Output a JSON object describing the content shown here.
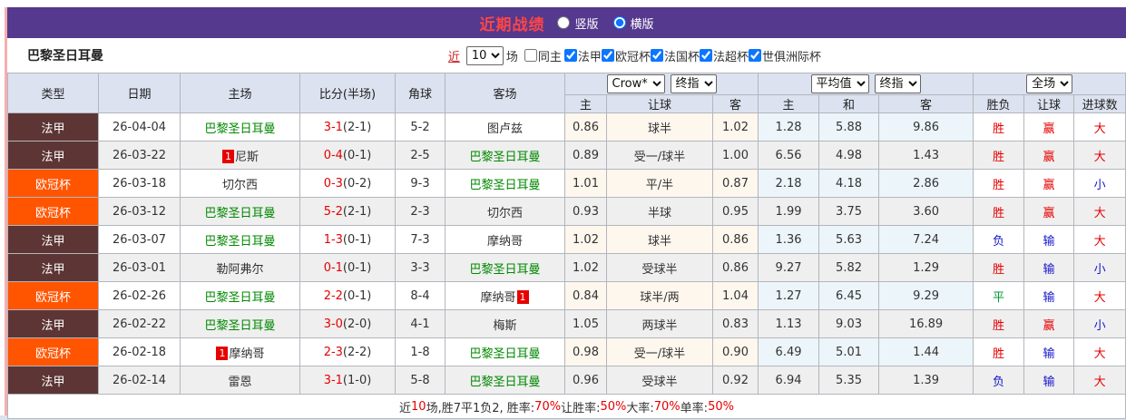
{
  "colors": {
    "titlebar_bg": "#54398e",
    "title_red": "#ff4545",
    "self_team_green": "#008800",
    "score_red": "#e60000",
    "result_red": "#e60000",
    "result_blue": "#1515cc",
    "result_green": "#009933",
    "type_colors": {
      "法甲": "#5d3535",
      "欧冠杯": "#ff5500"
    }
  },
  "title_bar": {
    "title": "近期战绩",
    "radio_vertical": "竖版",
    "radio_horizontal": "横版",
    "selected": "横版"
  },
  "filter_bar": {
    "team_name": "巴黎圣日耳曼",
    "recent_label": "近",
    "recent_count": "10",
    "matches_label": "场",
    "same_home_label": "同主",
    "same_home_checked": false,
    "leagues": [
      "法甲",
      "欧冠杯",
      "法国杯",
      "法超杯",
      "世俱洲际杯"
    ]
  },
  "table": {
    "selects": {
      "company": "Crow*",
      "stage1": "终指",
      "average": "平均值",
      "stage2": "终指",
      "scope": "全场"
    },
    "main_headers": [
      "类型",
      "日期",
      "主场",
      "比分(半场)",
      "角球",
      "客场"
    ],
    "sub_headers": [
      "主",
      "让球",
      "客",
      "主",
      "和",
      "客",
      "胜负",
      "让球",
      "进球数"
    ],
    "rows": [
      {
        "type": "法甲",
        "date": "26-04-04",
        "home": {
          "name": "巴黎圣日耳曼",
          "self": true
        },
        "ft": "3-1",
        "ht": "(2-1)",
        "corner": "5-2",
        "away": {
          "name": "图卢兹",
          "self": false
        },
        "odds": [
          "0.86",
          "球半",
          "1.02"
        ],
        "avg": [
          "1.28",
          "5.88",
          "9.86"
        ],
        "res": [
          [
            "胜",
            "r"
          ],
          [
            "赢",
            "r"
          ],
          [
            "大",
            "r"
          ]
        ]
      },
      {
        "type": "法甲",
        "date": "26-03-22",
        "home": {
          "name": "尼斯",
          "self": false,
          "badge": "1",
          "badge_pos": "before"
        },
        "ft": "0-4",
        "ht": "(0-1)",
        "corner": "2-5",
        "away": {
          "name": "巴黎圣日耳曼",
          "self": true
        },
        "odds": [
          "0.89",
          "受一/球半",
          "1.00"
        ],
        "avg": [
          "6.56",
          "4.98",
          "1.43"
        ],
        "res": [
          [
            "胜",
            "r"
          ],
          [
            "赢",
            "r"
          ],
          [
            "大",
            "r"
          ]
        ]
      },
      {
        "type": "欧冠杯",
        "date": "26-03-18",
        "home": {
          "name": "切尔西",
          "self": false
        },
        "ft": "0-3",
        "ht": "(0-2)",
        "corner": "9-3",
        "away": {
          "name": "巴黎圣日耳曼",
          "self": true
        },
        "odds": [
          "1.01",
          "平/半",
          "0.87"
        ],
        "avg": [
          "2.18",
          "4.18",
          "2.86"
        ],
        "res": [
          [
            "胜",
            "r"
          ],
          [
            "赢",
            "r"
          ],
          [
            "小",
            "b"
          ]
        ]
      },
      {
        "type": "欧冠杯",
        "date": "26-03-12",
        "home": {
          "name": "巴黎圣日耳曼",
          "self": true
        },
        "ft": "5-2",
        "ht": "(2-1)",
        "corner": "2-3",
        "away": {
          "name": "切尔西",
          "self": false
        },
        "odds": [
          "0.93",
          "半球",
          "0.95"
        ],
        "avg": [
          "1.99",
          "3.75",
          "3.60"
        ],
        "res": [
          [
            "胜",
            "r"
          ],
          [
            "赢",
            "r"
          ],
          [
            "大",
            "r"
          ]
        ]
      },
      {
        "type": "法甲",
        "date": "26-03-07",
        "home": {
          "name": "巴黎圣日耳曼",
          "self": true
        },
        "ft": "1-3",
        "ht": "(0-1)",
        "corner": "7-3",
        "away": {
          "name": "摩纳哥",
          "self": false
        },
        "odds": [
          "1.02",
          "球半",
          "0.86"
        ],
        "avg": [
          "1.36",
          "5.63",
          "7.24"
        ],
        "res": [
          [
            "负",
            "b"
          ],
          [
            "输",
            "b"
          ],
          [
            "大",
            "r"
          ]
        ]
      },
      {
        "type": "法甲",
        "date": "26-03-01",
        "home": {
          "name": "勒阿弗尔",
          "self": false
        },
        "ft": "0-1",
        "ht": "(0-1)",
        "corner": "3-3",
        "away": {
          "name": "巴黎圣日耳曼",
          "self": true
        },
        "odds": [
          "1.02",
          "受球半",
          "0.86"
        ],
        "avg": [
          "9.27",
          "5.82",
          "1.29"
        ],
        "res": [
          [
            "胜",
            "r"
          ],
          [
            "输",
            "b"
          ],
          [
            "小",
            "b"
          ]
        ]
      },
      {
        "type": "欧冠杯",
        "date": "26-02-26",
        "home": {
          "name": "巴黎圣日耳曼",
          "self": true
        },
        "ft": "2-2",
        "ht": "(0-1)",
        "corner": "8-4",
        "away": {
          "name": "摩纳哥",
          "self": false,
          "badge": "1",
          "badge_pos": "after"
        },
        "odds": [
          "0.84",
          "球半/两",
          "1.04"
        ],
        "avg": [
          "1.27",
          "6.45",
          "9.29"
        ],
        "res": [
          [
            "平",
            "g"
          ],
          [
            "输",
            "b"
          ],
          [
            "大",
            "r"
          ]
        ]
      },
      {
        "type": "法甲",
        "date": "26-02-22",
        "home": {
          "name": "巴黎圣日耳曼",
          "self": true
        },
        "ft": "3-0",
        "ht": "(2-0)",
        "corner": "4-1",
        "away": {
          "name": "梅斯",
          "self": false
        },
        "odds": [
          "1.05",
          "两球半",
          "0.83"
        ],
        "avg": [
          "1.13",
          "9.03",
          "16.89"
        ],
        "res": [
          [
            "胜",
            "r"
          ],
          [
            "赢",
            "r"
          ],
          [
            "小",
            "b"
          ]
        ]
      },
      {
        "type": "欧冠杯",
        "date": "26-02-18",
        "home": {
          "name": "摩纳哥",
          "self": false,
          "badge": "1",
          "badge_pos": "before"
        },
        "ft": "2-3",
        "ht": "(2-2)",
        "corner": "1-8",
        "away": {
          "name": "巴黎圣日耳曼",
          "self": true
        },
        "odds": [
          "0.98",
          "受一/球半",
          "0.90"
        ],
        "avg": [
          "6.49",
          "5.01",
          "1.44"
        ],
        "res": [
          [
            "胜",
            "r"
          ],
          [
            "输",
            "b"
          ],
          [
            "大",
            "r"
          ]
        ]
      },
      {
        "type": "法甲",
        "date": "26-02-14",
        "home": {
          "name": "雷恩",
          "self": false
        },
        "ft": "3-1",
        "ht": "(1-0)",
        "corner": "5-8",
        "away": {
          "name": "巴黎圣日耳曼",
          "self": true
        },
        "odds": [
          "0.96",
          "受球半",
          "0.92"
        ],
        "avg": [
          "6.94",
          "5.35",
          "1.39"
        ],
        "res": [
          [
            "负",
            "b"
          ],
          [
            "输",
            "b"
          ],
          [
            "大",
            "r"
          ]
        ]
      }
    ]
  },
  "footer": {
    "segments": [
      {
        "t": "近",
        "c": "k"
      },
      {
        "t": "10",
        "c": "r"
      },
      {
        "t": "场,胜7平1负2, 胜率:",
        "c": "k"
      },
      {
        "t": "70%",
        "c": "r"
      },
      {
        "t": " 让胜率:",
        "c": "k"
      },
      {
        "t": "50%",
        "c": "r"
      },
      {
        "t": " 大率:",
        "c": "k"
      },
      {
        "t": "70%",
        "c": "r"
      },
      {
        "t": " 单率:",
        "c": "k"
      },
      {
        "t": "50%",
        "c": "r"
      }
    ]
  }
}
